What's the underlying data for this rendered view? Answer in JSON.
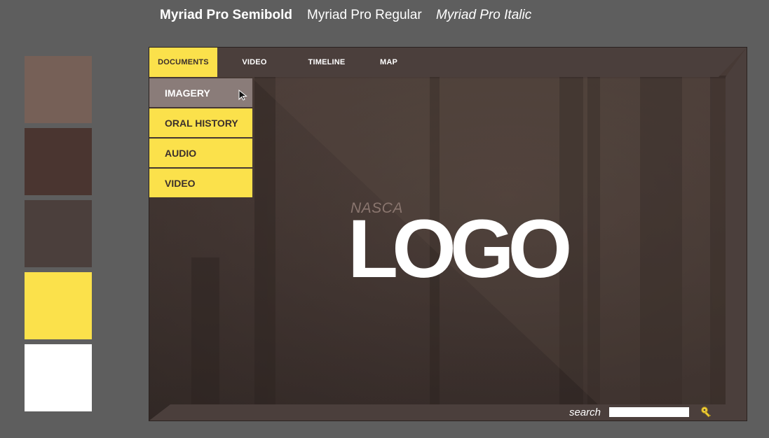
{
  "font_samples": {
    "semibold": "Myriad Pro Semibold",
    "regular": "Myriad Pro Regular",
    "italic": "Myriad Pro Italic"
  },
  "swatches": [
    {
      "name": "swatch-tan",
      "color": "#766057"
    },
    {
      "name": "swatch-dark-brown",
      "color": "#4a3530"
    },
    {
      "name": "swatch-brown-gray",
      "color": "#4b3f3c"
    },
    {
      "name": "swatch-yellow",
      "color": "#fbe14b"
    },
    {
      "name": "swatch-white",
      "color": "#ffffff"
    }
  ],
  "nav": {
    "tabs": [
      {
        "label": "DOCUMENTS",
        "active": true
      },
      {
        "label": "VIDEO",
        "active": false
      },
      {
        "label": "TIMELINE",
        "active": false
      },
      {
        "label": "MAP",
        "active": false
      }
    ]
  },
  "dropdown": {
    "items": [
      {
        "label": "IMAGERY",
        "hover": true
      },
      {
        "label": "ORAL HISTORY",
        "hover": false
      },
      {
        "label": "AUDIO",
        "hover": false
      },
      {
        "label": "VIDEO",
        "hover": false
      }
    ]
  },
  "logo": {
    "small": "NASCA",
    "big": "LOGO"
  },
  "search": {
    "label": "search",
    "value": "",
    "placeholder": ""
  },
  "colors": {
    "accent": "#fbe14b",
    "bar": "#4b3f3c",
    "hover_item": "#8a7c79"
  },
  "icons": {
    "search": "key-search-icon",
    "cursor": "arrow-cursor-icon"
  }
}
